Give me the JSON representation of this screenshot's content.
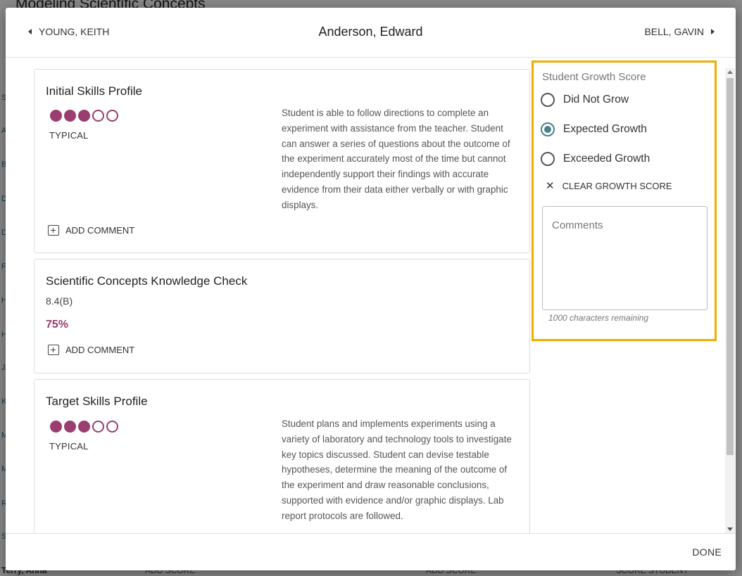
{
  "background": {
    "page_title": "Modeling Scientific Concepts",
    "left_column_letters": [
      "S",
      "A",
      "B",
      "D",
      "D",
      "F",
      "H",
      "H",
      "J",
      "K",
      "M",
      "M",
      "R",
      "S"
    ],
    "bottom_row": {
      "student": "Terry, Anna",
      "cell1": "ADD SCORE",
      "cell2": "ADD SCORE",
      "cell3": "SCORE STUDENT"
    }
  },
  "header": {
    "prev_student": "YOUNG, KEITH",
    "current_student": "Anderson, Edward",
    "next_student": "BELL, GAVIN"
  },
  "cards": [
    {
      "title": "Initial Skills Profile",
      "rating": {
        "filled": 3,
        "total": 5,
        "label": "TYPICAL"
      },
      "description": "Student is able to follow directions to complete an experiment with assistance from the teacher. Student can answer a series of questions about the outcome of the experiment accurately most of the time but cannot independently support their findings with accurate evidence from their data either verbally or with graphic displays.",
      "add_comment_label": "ADD COMMENT"
    },
    {
      "title": "Scientific Concepts Knowledge Check",
      "subtext": "8.4(B)",
      "percent": "75%",
      "add_comment_label": "ADD COMMENT"
    },
    {
      "title": "Target Skills Profile",
      "rating": {
        "filled": 3,
        "total": 5,
        "label": "TYPICAL"
      },
      "description": "Student plans and implements experiments using a variety of laboratory and technology tools to investigate key topics discussed. Student can devise testable hypotheses, determine the meaning of the outcome of the experiment and draw reasonable conclusions, supported with evidence and/or graphic displays. Lab report protocols are followed."
    }
  ],
  "growth": {
    "title": "Student Growth Score",
    "options": [
      "Did Not Grow",
      "Expected Growth",
      "Exceeded Growth"
    ],
    "selected": "Expected Growth",
    "clear_label": "CLEAR GROWTH SCORE",
    "comments_placeholder": "Comments",
    "chars_remaining": "1000 characters remaining"
  },
  "footer": {
    "done_label": "DONE"
  },
  "colors": {
    "accent": "#9a3d6f",
    "highlight": "#f0ad00",
    "radio": "#4a7f8c"
  }
}
